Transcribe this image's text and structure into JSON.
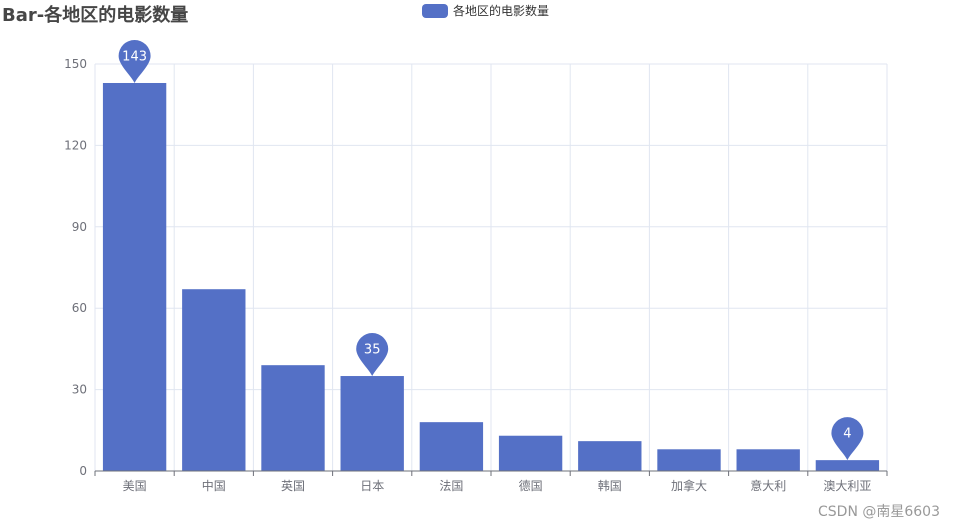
{
  "title": "Bar-各地区的电影数量",
  "legend": {
    "label": "各地区的电影数量",
    "color": "#5470c6"
  },
  "watermark": "CSDN @南星6603",
  "colors": {
    "bar": "#5470c6",
    "grid": "#e0e6f1",
    "axis": "#6e7079",
    "label": "#6e7079",
    "pin_text": "#ffffff"
  },
  "chart_data": {
    "type": "bar",
    "categories": [
      "美国",
      "中国",
      "英国",
      "日本",
      "法国",
      "德国",
      "韩国",
      "加拿大",
      "意大利",
      "澳大利亚"
    ],
    "series": [
      {
        "name": "各地区的电影数量",
        "values": [
          143,
          67,
          39,
          35,
          18,
          13,
          11,
          8,
          8,
          4
        ]
      }
    ],
    "ylim": [
      0,
      150
    ],
    "yticks": [
      0,
      30,
      60,
      90,
      120,
      150
    ],
    "grid": true,
    "legend_position": "top",
    "mark_points": [
      {
        "category": "美国",
        "value": 143
      },
      {
        "category": "日本",
        "value": 35
      },
      {
        "category": "澳大利亚",
        "value": 4
      }
    ]
  }
}
